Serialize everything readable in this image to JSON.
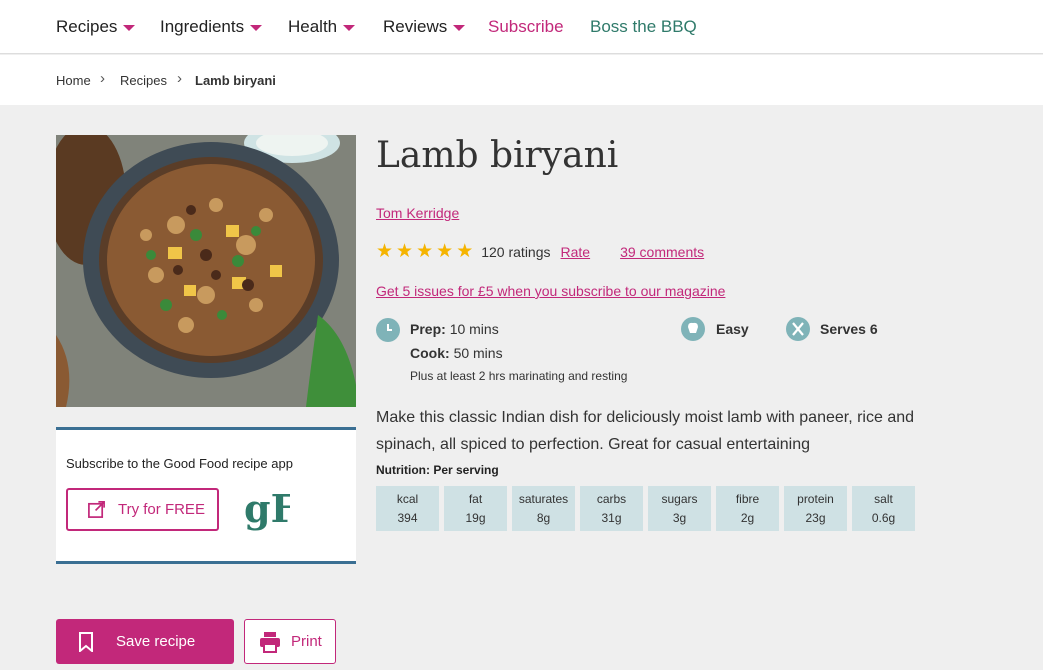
{
  "nav": {
    "items": [
      {
        "label": "Recipes"
      },
      {
        "label": "Ingredients"
      },
      {
        "label": "Health"
      },
      {
        "label": "Reviews"
      }
    ],
    "subscribe": "Subscribe",
    "bbq": "Boss the BBQ"
  },
  "breadcrumb": {
    "home": "Home",
    "recipes": "Recipes",
    "current": "Lamb biryani"
  },
  "recipe": {
    "title": "Lamb biryani",
    "author": "Tom Kerridge",
    "rating_stars": 5,
    "ratings_count": "120 ratings",
    "rate_label": "Rate",
    "comments": "39 comments",
    "promo": "Get 5 issues for £5 when you subscribe to our magazine",
    "prep_label": "Prep:",
    "prep_value": "10 mins",
    "cook_label": "Cook:",
    "cook_value": "50 mins",
    "time_note": "Plus at least 2 hrs marinating and resting",
    "difficulty": "Easy",
    "serves": "Serves 6",
    "description": "Make this classic Indian dish for deliciously moist lamb with paneer, rice and spinach, all spiced to perfection. Great for casual entertaining",
    "nutrition_title": "Nutrition: Per serving",
    "nutrition": [
      {
        "label": "kcal",
        "value": "394"
      },
      {
        "label": "fat",
        "value": "19g"
      },
      {
        "label": "saturates",
        "value": "8g"
      },
      {
        "label": "carbs",
        "value": "31g"
      },
      {
        "label": "sugars",
        "value": "3g"
      },
      {
        "label": "fibre",
        "value": "2g"
      },
      {
        "label": "protein",
        "value": "23g"
      },
      {
        "label": "salt",
        "value": "0.6g"
      }
    ]
  },
  "app_box": {
    "text": "Subscribe to the Good Food recipe app",
    "try_label": "Try for FREE",
    "logo_text": "gF"
  },
  "actions": {
    "save": "Save recipe",
    "print": "Print"
  },
  "colors": {
    "accent": "#c2287a",
    "teal": "#2f7a6a",
    "icon_bg": "#7fb3b8",
    "nutrition_bg": "#cfe1e4",
    "star": "#f5b400"
  }
}
